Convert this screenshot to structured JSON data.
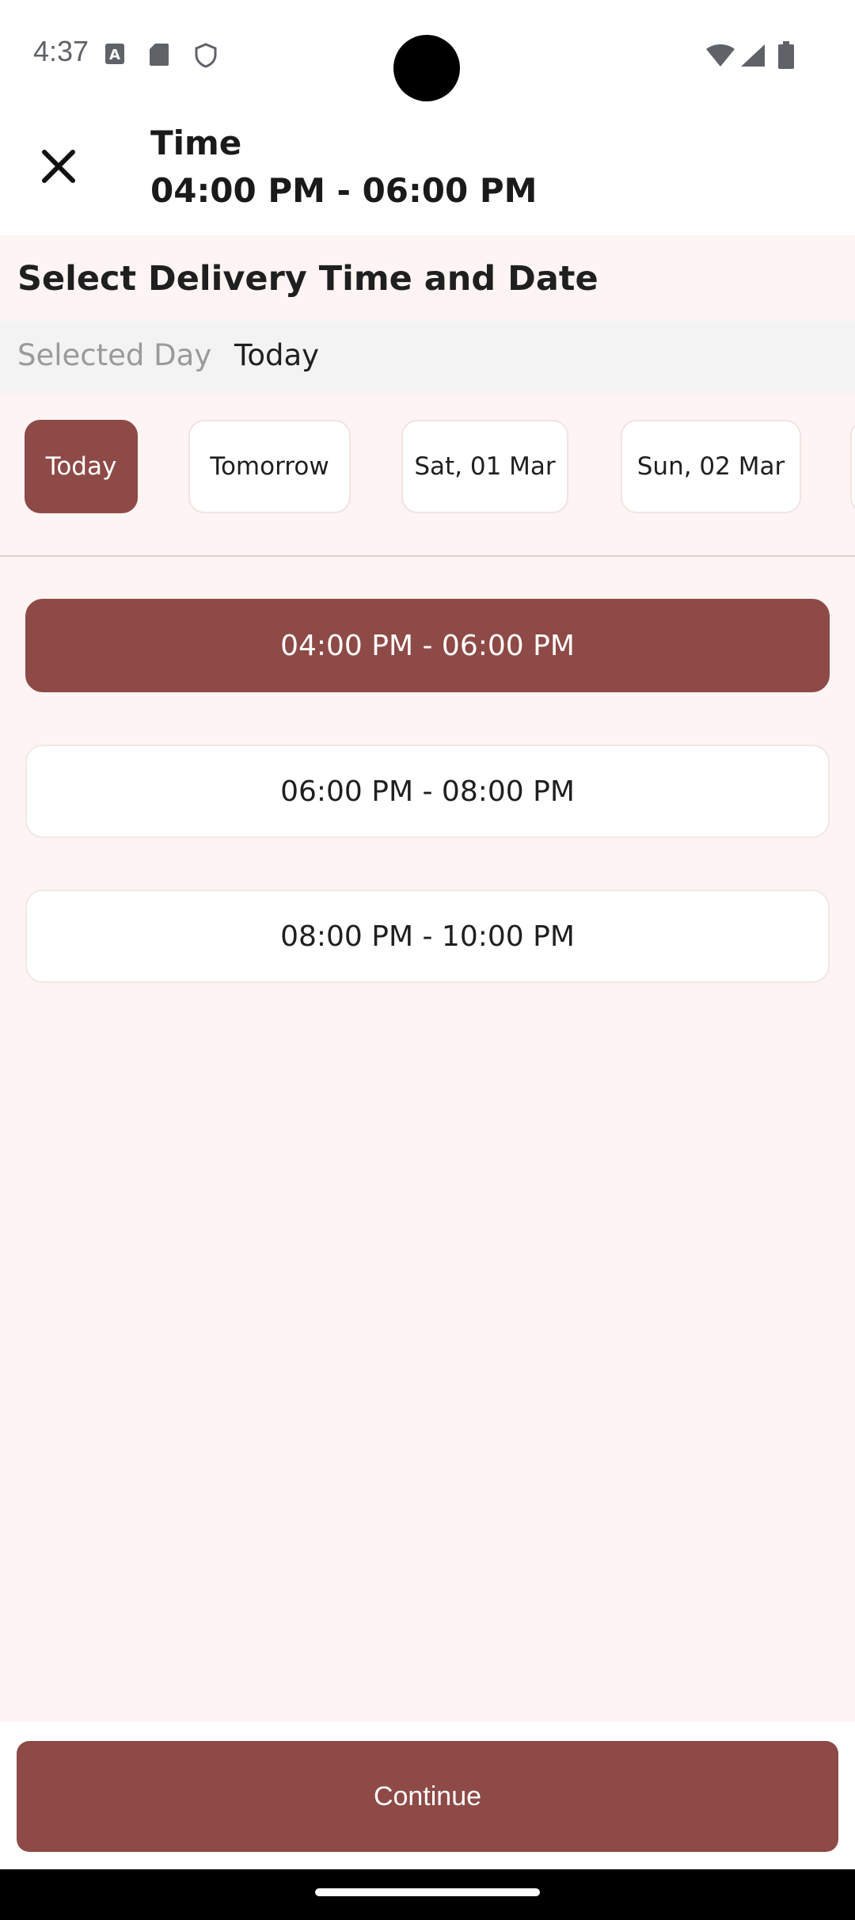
{
  "status_bar": {
    "time": "4:37",
    "left_icons": [
      "text-a-icon",
      "sd-card-icon",
      "shield-icon"
    ],
    "right_icons": [
      "wifi-icon",
      "signal-icon",
      "battery-icon"
    ]
  },
  "header": {
    "close_icon": "close-icon",
    "title": "Time",
    "subtitle": "04:00 PM - 06:00 PM"
  },
  "section": {
    "title": "Select Delivery Time and Date",
    "selected_day_label": "Selected Day",
    "selected_day_value": "Today"
  },
  "days": [
    {
      "label": "Today",
      "selected": true
    },
    {
      "label": "Tomorrow",
      "selected": false
    },
    {
      "label": "Sat, 01 Mar",
      "selected": false
    },
    {
      "label": "Sun, 02 Mar",
      "selected": false
    }
  ],
  "slots": [
    {
      "label": "04:00 PM - 06:00 PM",
      "selected": true
    },
    {
      "label": "06:00 PM - 08:00 PM",
      "selected": false
    },
    {
      "label": "08:00 PM - 10:00 PM",
      "selected": false
    }
  ],
  "footer": {
    "continue_label": "Continue"
  },
  "colors": {
    "accent": "#8e4a46",
    "background": "#fdf4f3"
  }
}
